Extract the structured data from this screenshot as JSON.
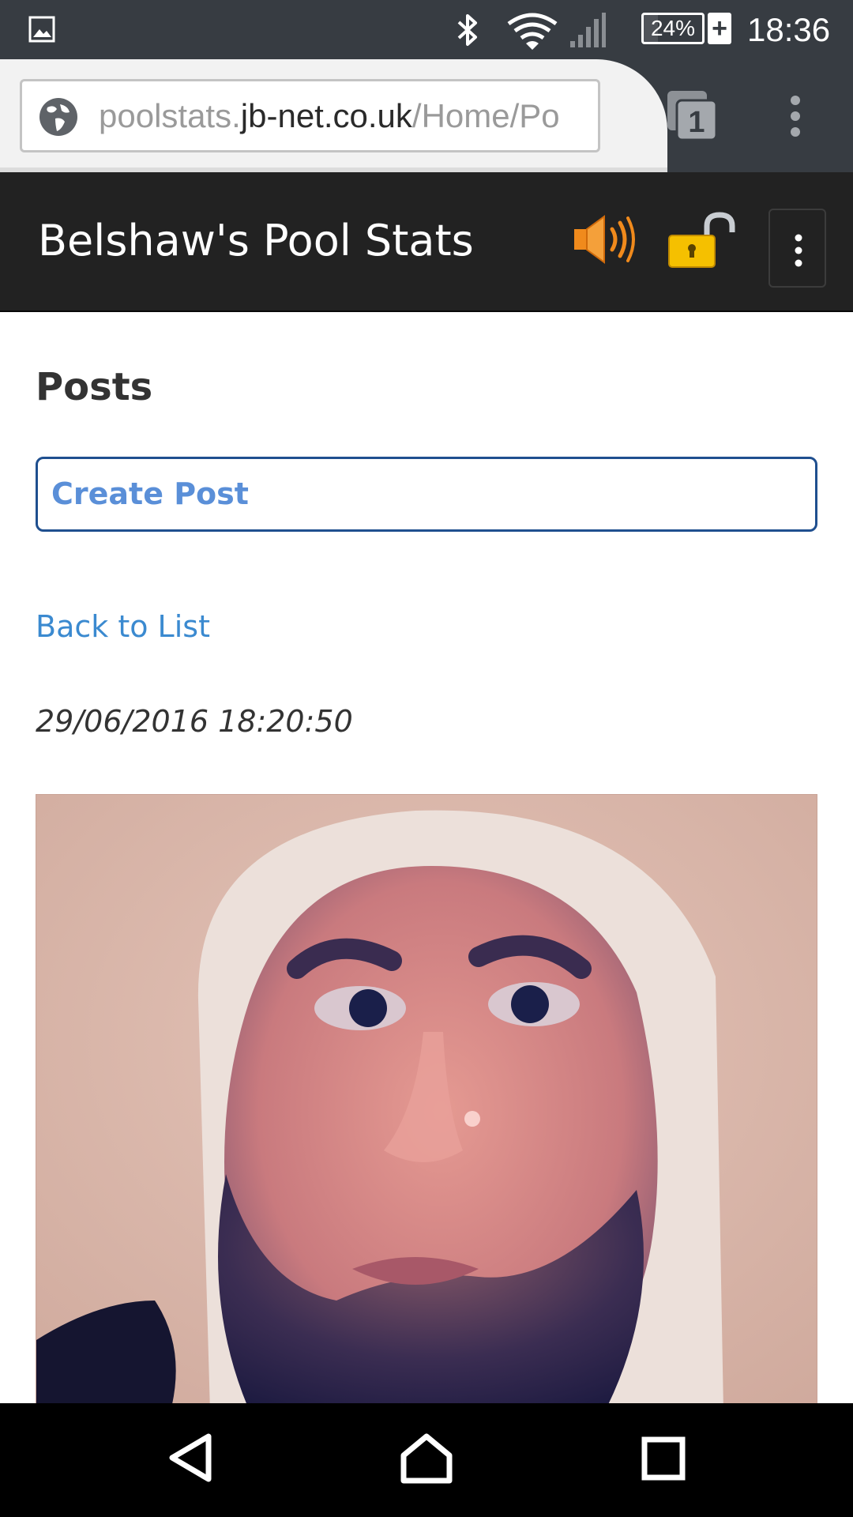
{
  "status_bar": {
    "notification_icon": "gallery-icon",
    "bluetooth_icon": "bluetooth-icon",
    "wifi_icon": "wifi-icon",
    "signal_icon": "cell-signal-icon",
    "battery_level": 0.24,
    "battery_text": "24%",
    "charging_symbol": "+",
    "time": "18:36"
  },
  "browser": {
    "url_scheme_part": "poolstats.",
    "url_domain_part": "jb-net.co.uk",
    "url_path_part": "/Home/Po",
    "site_icon": "globe-icon",
    "tab_count": "1",
    "menu_icon": "more-vert-icon"
  },
  "site_nav": {
    "brand": "Belshaw's Pool Stats",
    "sound_icon": "speaker-icon",
    "lock_icon": "unlocked-padlock-icon",
    "toggle_icon": "more-vert-icon",
    "accent_colors": {
      "speaker": "#f08a1c",
      "lock": "#f5c000"
    }
  },
  "main": {
    "title": "Posts",
    "create_button": "Create Post",
    "back_link": "Back to List",
    "post_date": "29/06/2016 18:20:50",
    "photo_alt": "post-photo"
  },
  "nav_bar": {
    "back_icon": "back-triangle-icon",
    "home_icon": "home-icon",
    "recents_icon": "recents-square-icon"
  },
  "colors": {
    "status_bar": "#373c42",
    "site_nav": "#222222",
    "link": "#3b8ad0",
    "button_border": "#1f4f8f",
    "button_text": "#5a8fd8"
  }
}
